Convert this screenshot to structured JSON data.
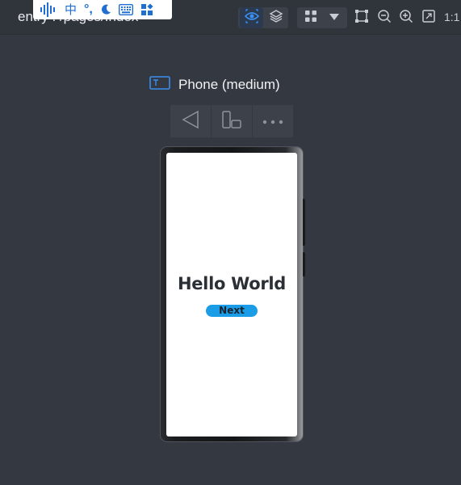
{
  "window": {
    "path_title": "entry : /pages/Index"
  },
  "ime_bar": {
    "mode_char": "中",
    "punct_char": "°,",
    "icons": [
      "voice-icon",
      "chinese-mode-icon",
      "punctuation-icon",
      "moon-icon",
      "keyboard-icon",
      "toolbox-icon"
    ]
  },
  "toolbar": {
    "zoom_reset_label": "1:1",
    "icons": [
      "preview-eye-icon",
      "layers-icon",
      "grid-apps-icon",
      "dropdown-triangle-icon",
      "crop-frame-icon",
      "zoom-out-icon",
      "zoom-in-icon",
      "fit-screen-icon"
    ]
  },
  "device": {
    "name": "Phone (medium)",
    "controls": [
      "back-triangle-icon",
      "rotate-device-icon",
      "more-icon"
    ]
  },
  "preview": {
    "heading": "Hello World",
    "button_label": "Next"
  },
  "colors": {
    "background": "#343840",
    "accent": "#1f6fd1",
    "button": "#1a9ce6"
  }
}
